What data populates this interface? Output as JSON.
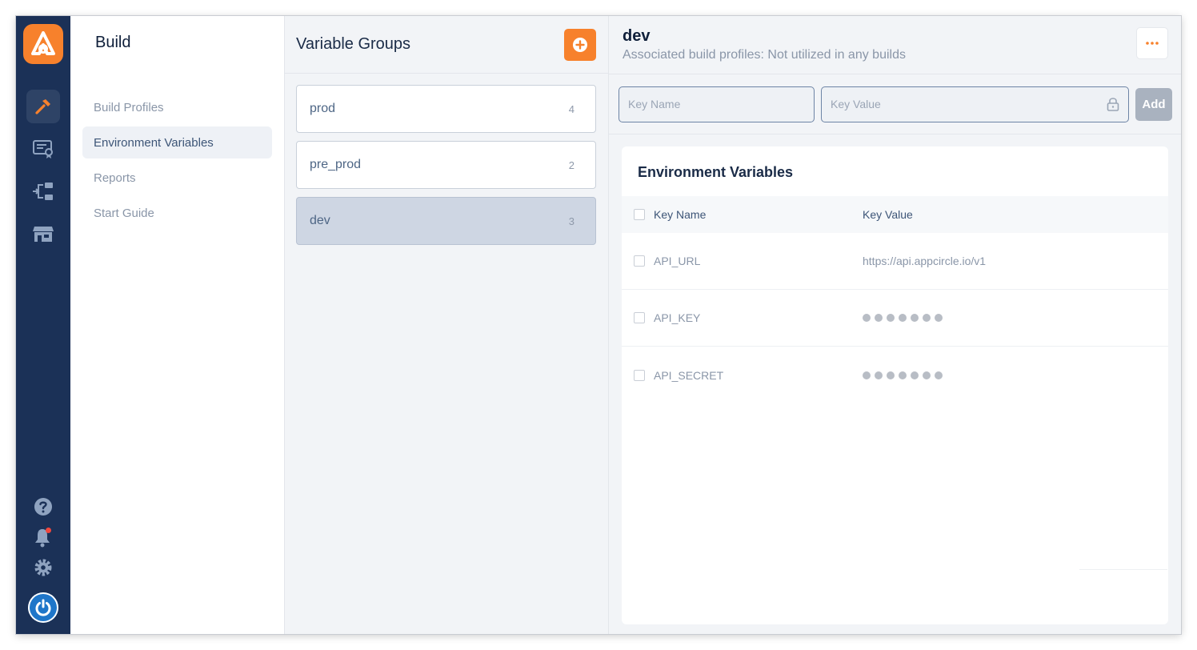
{
  "rail": {
    "logo": "appcircle-logo",
    "nav": [
      {
        "icon": "hammer-icon",
        "active": true
      },
      {
        "icon": "certificate-icon",
        "active": false
      },
      {
        "icon": "distribution-icon",
        "active": false
      },
      {
        "icon": "store-icon",
        "active": false
      }
    ],
    "bottom": [
      "help-icon",
      "bell-icon",
      "gear-icon",
      "power-icon"
    ]
  },
  "sidebar": {
    "title": "Build",
    "items": [
      {
        "label": "Build Profiles",
        "active": false
      },
      {
        "label": "Environment Variables",
        "active": true
      },
      {
        "label": "Reports",
        "active": false
      },
      {
        "label": "Start Guide",
        "active": false
      }
    ]
  },
  "groups": {
    "title": "Variable Groups",
    "items": [
      {
        "name": "prod",
        "count": "4"
      },
      {
        "name": "pre_prod",
        "count": "2"
      },
      {
        "name": "dev",
        "count": "3",
        "selected": true
      }
    ]
  },
  "details": {
    "name": "dev",
    "subtitle": "Associated build profiles: Not utilized in any builds",
    "key_placeholder": "Key Name",
    "value_placeholder": "Key Value",
    "add_label": "Add",
    "card_title": "Environment Variables",
    "columns": {
      "key": "Key Name",
      "value": "Key Value"
    },
    "rows": [
      {
        "key": "API_URL",
        "value": "https://api.appcircle.io/v1",
        "masked": false
      },
      {
        "key": "API_KEY",
        "value": "",
        "masked": true
      },
      {
        "key": "API_SECRET",
        "value": "",
        "masked": true
      }
    ]
  },
  "colors": {
    "accent": "#f7812c",
    "rail": "#1b3157",
    "selected_group": "#ced6e3"
  }
}
